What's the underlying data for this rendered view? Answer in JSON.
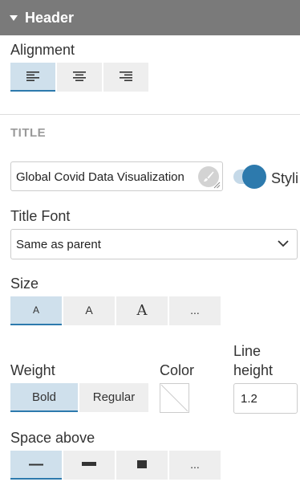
{
  "header": {
    "title": "Header"
  },
  "alignment": {
    "label": "Alignment",
    "selected": "left",
    "options": [
      "left",
      "center",
      "right"
    ]
  },
  "title_section": {
    "heading": "TITLE",
    "input_value": "Global Covid Data Visualization",
    "toggle_label": "Styli"
  },
  "title_font": {
    "label": "Title Font",
    "selected": "Same as parent"
  },
  "size": {
    "label": "Size",
    "options": [
      "A",
      "A",
      "A",
      "..."
    ],
    "selected_index": 0
  },
  "weight": {
    "label": "Weight",
    "options": [
      "Bold",
      "Regular"
    ],
    "selected": "Bold"
  },
  "color": {
    "label": "Color"
  },
  "line_height": {
    "label_line1": "Line",
    "label_line2": "height",
    "value": "1.2"
  },
  "space_above": {
    "label": "Space above",
    "more": "...",
    "selected_index": 0
  },
  "colors": {
    "accent": "#2d7aad",
    "active_bg": "#cfe0ec",
    "header_bg": "#7a7a7a"
  }
}
